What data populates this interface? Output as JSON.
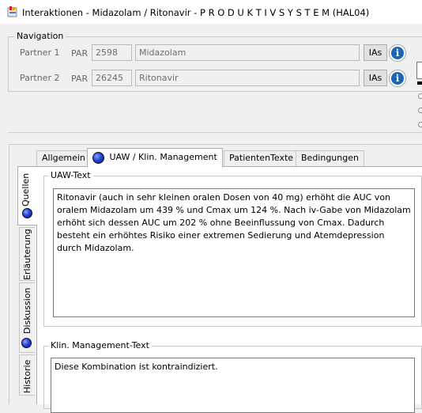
{
  "window": {
    "title": "Interaktionen - Midazolam / Ritonavir - P R O D U K T I V S Y S T E M (HAL04)"
  },
  "navigation": {
    "legend": "Navigation",
    "partners": [
      {
        "label": "Partner 1",
        "par_label": "PAR",
        "id": "2598",
        "name": "Midazolam",
        "ias_button": "IAs"
      },
      {
        "label": "Partner 2",
        "par_label": "PAR",
        "id": "26245",
        "name": "Ritonavir",
        "ias_button": "IAs"
      }
    ],
    "info_glyph": "i"
  },
  "tabs": {
    "items": [
      {
        "label": "Allgemein",
        "active": false
      },
      {
        "label": "UAW / Klin. Management",
        "active": true,
        "indicator": true
      },
      {
        "label": "PatientenTexte",
        "active": false
      },
      {
        "label": "Bedingungen",
        "active": false
      }
    ]
  },
  "vertical_tabs": {
    "items": [
      {
        "label": "Quellen",
        "indicator": true,
        "active": true
      },
      {
        "label": "Erläuterung",
        "indicator": false,
        "active": false
      },
      {
        "label": "Diskussion",
        "indicator": true,
        "active": false
      },
      {
        "label": "Historie",
        "indicator": false,
        "active": false
      }
    ]
  },
  "uaw": {
    "legend": "UAW-Text",
    "text": "Ritonavir (auch in sehr kleinen oralen Dosen von 40 mg) erhöht die AUC von oralem Midazolam um 439 % und Cmax um 124 %. Nach iv-Gabe von Midazolam erhöht sich dessen AUC um 202 % ohne Beeinflussung von Cmax. Dadurch besteht ein erhöhtes Risiko einer extremen Sedierung und Atemdepression durch Midazolam."
  },
  "klin": {
    "legend": "Klin. Management-Text",
    "text": "Diese Kombination ist kontraindiziert."
  },
  "colors": {
    "indicator_ball": "#2544d8",
    "info_button": "#1766b8"
  }
}
